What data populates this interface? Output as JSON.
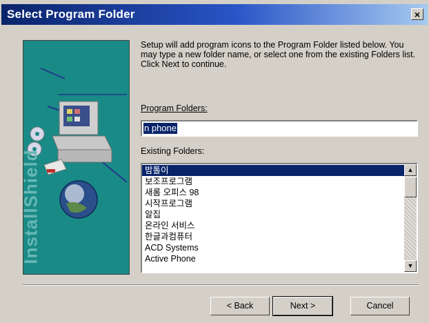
{
  "window": {
    "title": "Select Program Folder",
    "close_glyph": "×"
  },
  "side_panel": {
    "brand": "InstallShield"
  },
  "description": "Setup will add program icons to the Program Folder listed below. You may type a new folder name, or select one from the existing Folders list.  Click Next to continue.",
  "program_folders": {
    "label": "Program Folders:",
    "value": "n phone"
  },
  "existing_folders": {
    "label": "Existing Folders:",
    "items": [
      "밤톨이",
      "보조프로그램",
      "새롬 오피스 98",
      "시작프로그램",
      "알집",
      "온라인 서비스",
      "한글과컴퓨터",
      "ACD Systems",
      "Active Phone"
    ],
    "selected_index": 0
  },
  "scrollbar": {
    "up_glyph": "▲",
    "down_glyph": "▼"
  },
  "buttons": {
    "back": "< Back",
    "next": "Next >",
    "cancel": "Cancel"
  },
  "colors": {
    "title_start": "#0a246a",
    "title_end": "#a6caf0",
    "panel": "#1a8a86",
    "selection": "#0a246a",
    "dialog_bg": "#d4d0c8"
  }
}
